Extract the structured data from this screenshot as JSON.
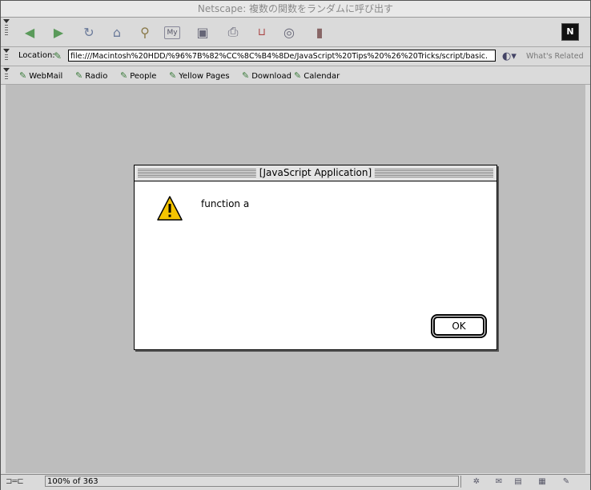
{
  "window": {
    "title": "Netscape: 複数の関数をランダムに呼び出す"
  },
  "nav_toolbar": {
    "buttons": [
      {
        "icon": "back-arrow-icon",
        "glyph": "◀"
      },
      {
        "icon": "forward-arrow-icon",
        "glyph": "▶"
      },
      {
        "icon": "reload-icon",
        "glyph": "↻"
      },
      {
        "icon": "home-icon",
        "glyph": "⌂"
      },
      {
        "icon": "search-icon",
        "glyph": "⚲"
      },
      {
        "icon": "my-netscape-icon",
        "glyph": "My"
      },
      {
        "icon": "images-icon",
        "glyph": "▣"
      },
      {
        "icon": "print-icon",
        "glyph": "⎙"
      },
      {
        "icon": "security-lock-icon",
        "glyph": "🔓"
      },
      {
        "icon": "shop-icon",
        "glyph": "◎"
      },
      {
        "icon": "stop-icon",
        "glyph": "▮"
      }
    ],
    "logo_text": "N"
  },
  "location_bar": {
    "label": "Location:",
    "url": "file:///Macintosh%20HDD/%96%7B%82%CC%8C%B4%8De/JavaScript%20Tips%20%26%20Tricks/script/basic.",
    "whats_related_label": "What's Related"
  },
  "personal_toolbar": {
    "items": [
      "WebMail",
      "Radio",
      "People",
      "Yellow Pages",
      "Download",
      "Calendar"
    ]
  },
  "dialog": {
    "title": "[JavaScript Application]",
    "message": "function a",
    "ok_label": "OK"
  },
  "status_bar": {
    "text": "100% of 363"
  },
  "colors": {
    "content_bg": "#bdbdbd",
    "warning_yellow": "#f5c400"
  }
}
